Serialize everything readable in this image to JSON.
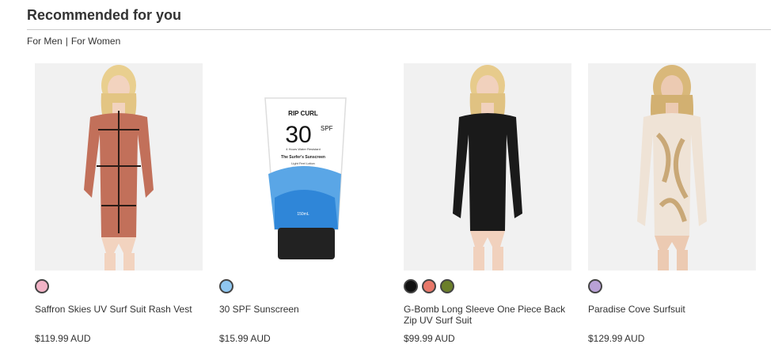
{
  "heading": "Recommended for you",
  "filters": [
    "For Men",
    "For Women"
  ],
  "products": [
    {
      "name": "Saffron Skies UV Surf Suit Rash Vest",
      "price": "$119.99 AUD",
      "swatches": [
        "#f2b3c6"
      ]
    },
    {
      "name": "30 SPF Sunscreen",
      "price": "$15.99 AUD",
      "swatches": [
        "#8fc6f0"
      ]
    },
    {
      "name": "G-Bomb Long Sleeve One Piece Back Zip UV Surf Suit",
      "price": "$99.99 AUD",
      "swatches": [
        "#111111",
        "#e8786a",
        "#6b7f2a"
      ]
    },
    {
      "name": "Paradise Cove Surfsuit",
      "price": "$129.99 AUD",
      "swatches": [
        "#b9a1d6"
      ]
    }
  ],
  "sunscreen_label": {
    "brand": "RIP CURL",
    "spf": "30",
    "spf_unit": "SPF",
    "water": "4 Hours Water Resistant",
    "tagline": "The Surfer's Sunscreen",
    "sub": "Light Feel Lotion",
    "volume": "150mL"
  }
}
